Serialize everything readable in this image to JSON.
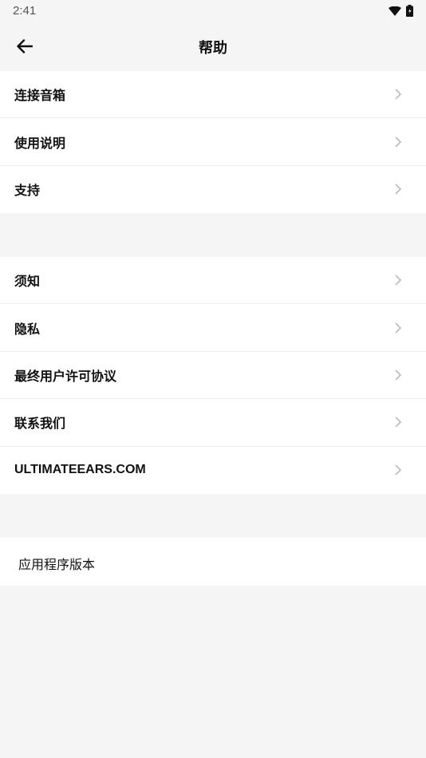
{
  "status_bar": {
    "time": "2:41",
    "icons": [
      "wifi-icon",
      "battery-icon"
    ]
  },
  "header": {
    "title": "帮助",
    "back_icon": "arrow-left-icon"
  },
  "group1": {
    "items": [
      {
        "label": "连接音箱"
      },
      {
        "label": "使用说明"
      },
      {
        "label": "支持"
      }
    ]
  },
  "group2": {
    "items": [
      {
        "label": "须知"
      },
      {
        "label": "隐私"
      },
      {
        "label": "最终用户许可协议"
      },
      {
        "label": "联系我们"
      },
      {
        "label": "ULTIMATEEARS.COM"
      }
    ]
  },
  "app_version": {
    "label": "应用程序版本"
  },
  "colors": {
    "background": "#f5f5f5",
    "card": "#ffffff",
    "text": "#111111",
    "chevron": "#bbbbbb"
  }
}
